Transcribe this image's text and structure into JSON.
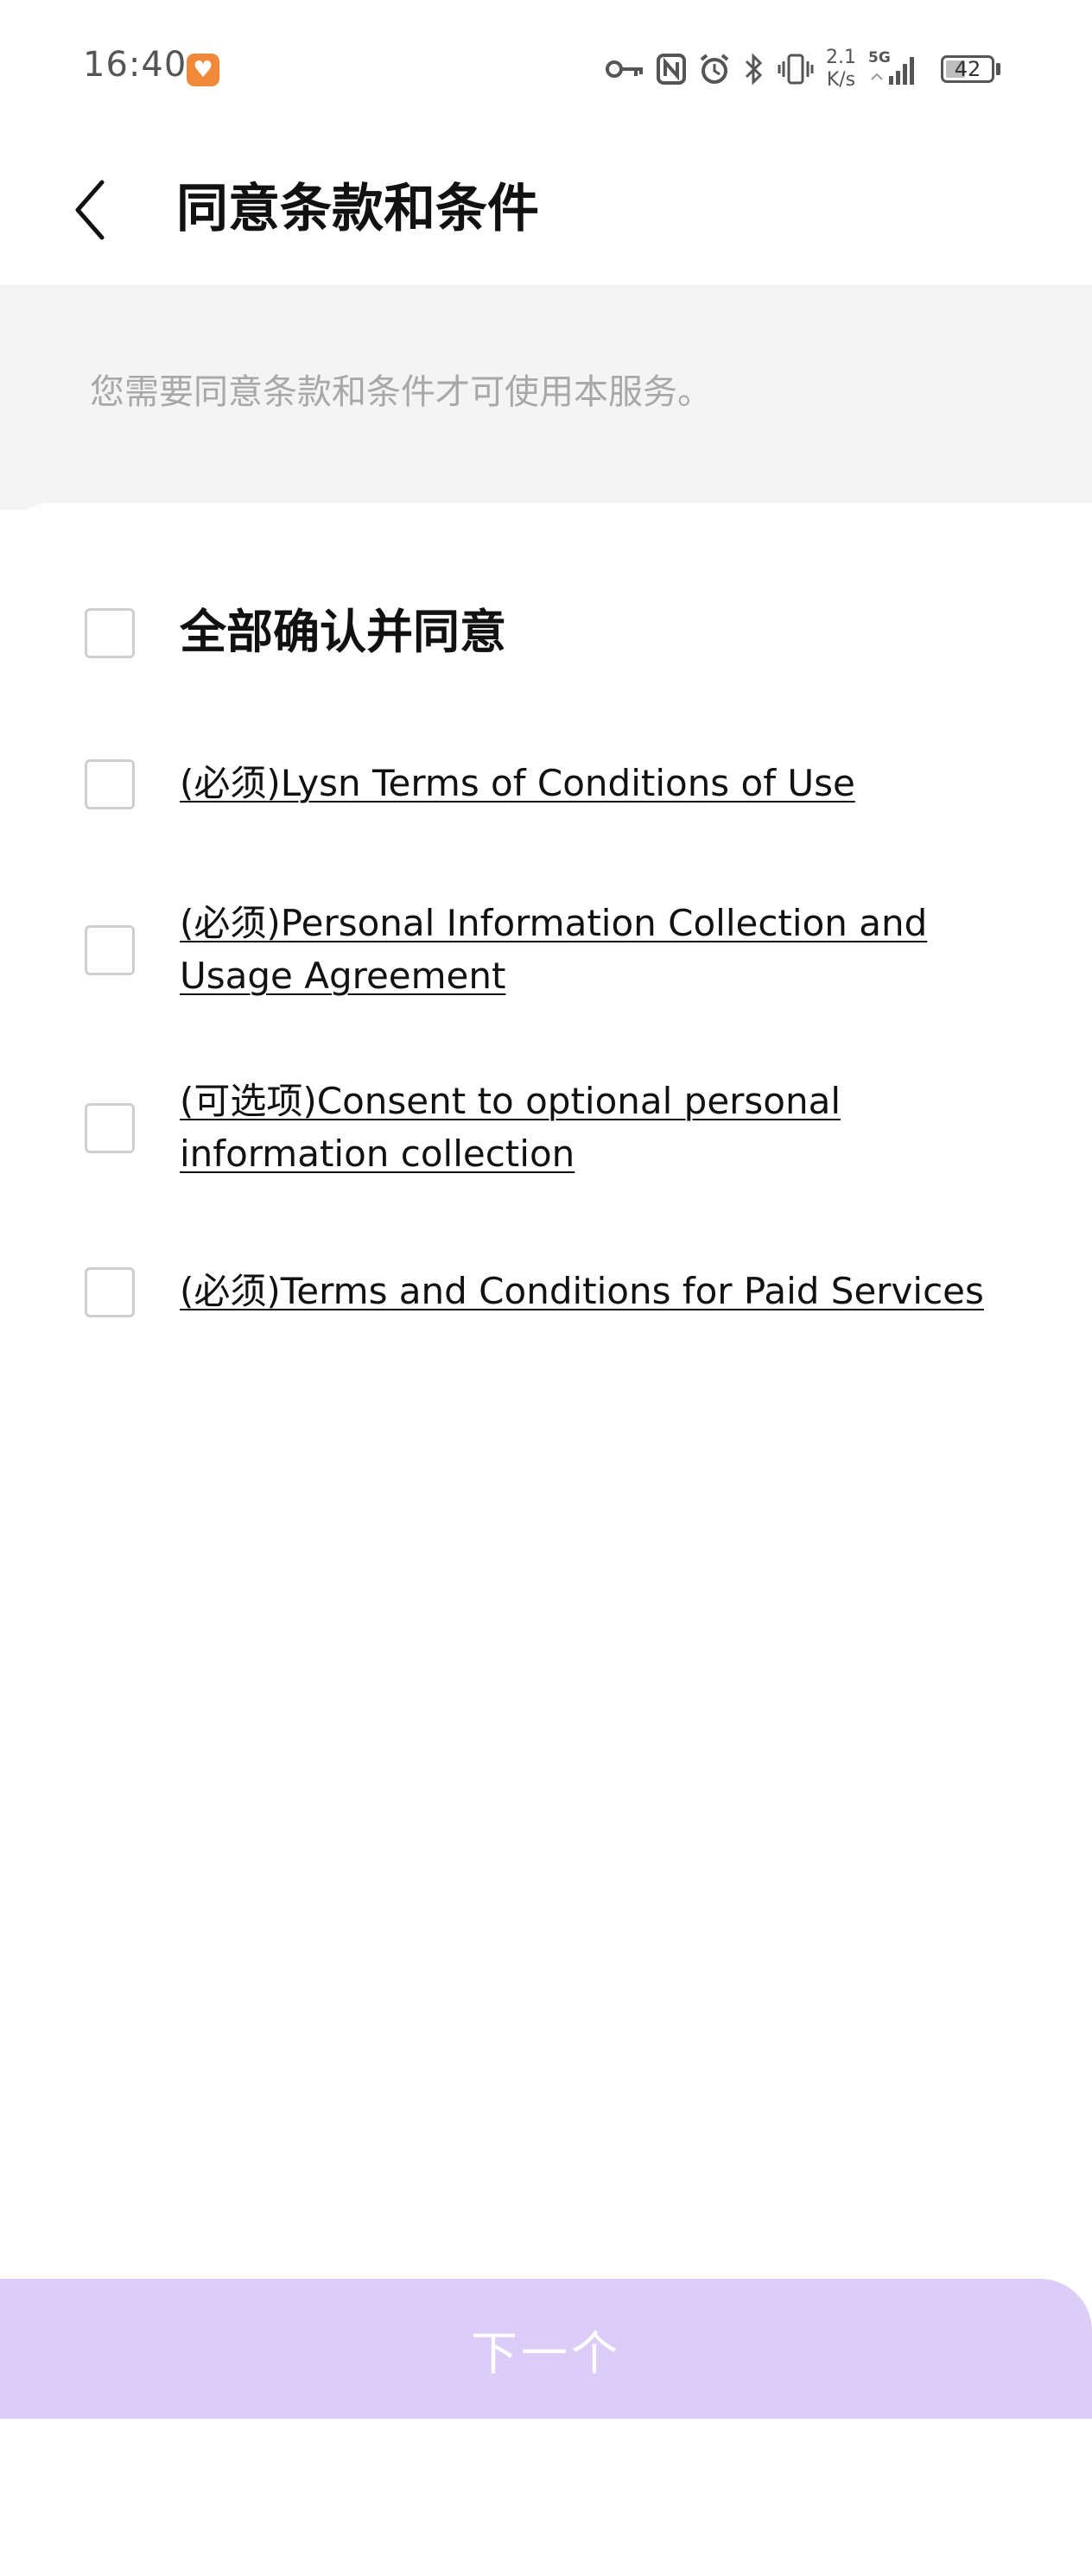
{
  "status_bar": {
    "time": "16:40",
    "app_badge_icon": "heart-badge-icon",
    "net_speed_value": "2.1",
    "net_speed_unit": "K/s",
    "network_type": "5G",
    "battery_level": "42"
  },
  "header": {
    "title": "同意条款和条件",
    "back_icon": "chevron-left-icon"
  },
  "info": {
    "text": "您需要同意条款和条件才可使用本服务。"
  },
  "agreements": {
    "all_label": "全部确认并同意",
    "items": [
      {
        "label": "(必须)Lysn Terms of Conditions of Use",
        "checked": false
      },
      {
        "label": "(必须)Personal Information Collection and Usage Agreement",
        "checked": false
      },
      {
        "label": "(可选项)Consent to optional personal information collection",
        "checked": false
      },
      {
        "label": "(必须)Terms and Conditions for Paid Services",
        "checked": false
      }
    ]
  },
  "footer": {
    "next_label": "下一个"
  },
  "colors": {
    "next_button_bg": "#dccdf8",
    "banner_bg": "#f4f4f4",
    "checkbox_border": "#cfcfcf"
  }
}
